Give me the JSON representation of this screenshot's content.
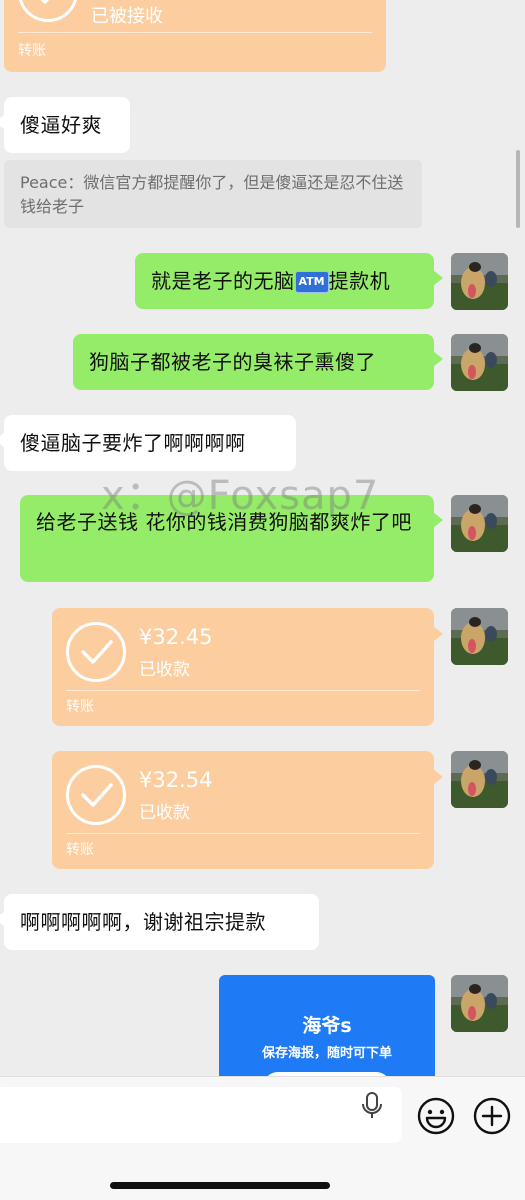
{
  "top_transfer": {
    "status": "已被接收",
    "label": "转账"
  },
  "messages": [
    {
      "side": "left",
      "text": "傻逼好爽"
    },
    {
      "side": "right",
      "text_before": "就是老子的无脑",
      "badge": "ATM",
      "text_after": "提款机"
    },
    {
      "side": "right",
      "text": "狗脑子都被老子的臭袜子熏傻了"
    },
    {
      "side": "left",
      "text": "傻逼脑子要炸了啊啊啊啊"
    },
    {
      "side": "right",
      "text": "给老子送钱 花你的钱消费狗脑都爽炸了吧"
    },
    {
      "side": "left",
      "text": "啊啊啊啊啊，谢谢祖宗提款"
    }
  ],
  "quote": {
    "text": "Peace：微信官方都提醒你了，但是傻逼还是忍不住送钱给老子"
  },
  "transfers": [
    {
      "amount": "¥32.45",
      "status": "已收款",
      "label": "转账"
    },
    {
      "amount": "¥32.54",
      "status": "已收款",
      "label": "转账"
    }
  ],
  "poster": {
    "title": "海爷s",
    "subtitle": "保存海报，随时可下单"
  },
  "watermark": "x：@Foxsap7",
  "icons": {
    "avatar": "dog-avatar",
    "transfer_received": "check-circle-icon",
    "voice": "microphone-icon",
    "emoji": "smiley-icon",
    "more": "plus-circle-icon"
  },
  "colors": {
    "background": "#ededed",
    "incoming_bubble": "#ffffff",
    "outgoing_bubble": "#95ec69",
    "transfer_card": "#fcce9f",
    "poster_card": "#1f7bf5"
  }
}
